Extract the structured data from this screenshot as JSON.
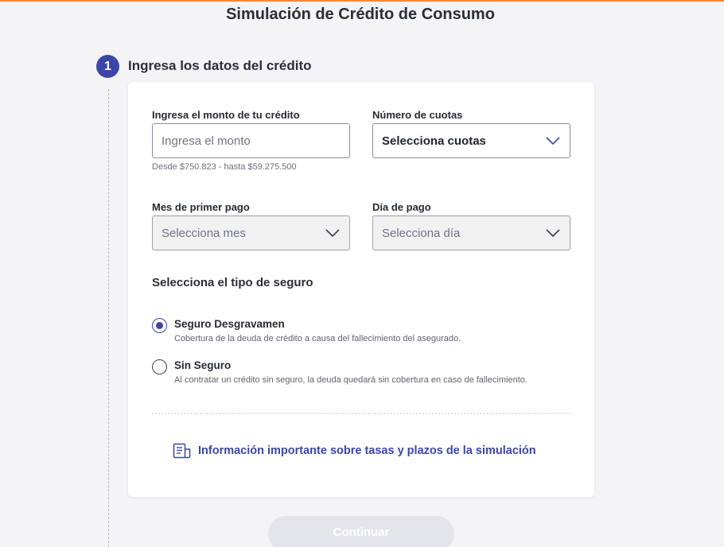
{
  "page": {
    "title": "Simulación de Crédito de Consumo"
  },
  "step": {
    "number": "1",
    "title": "Ingresa los datos del crédito"
  },
  "form": {
    "amount": {
      "label": "Ingresa el monto de tu crédito",
      "placeholder": "Ingresa el monto",
      "value": "",
      "hint": "Desde $750.823 - hasta $59.275.500"
    },
    "installments": {
      "label": "Número de cuotas",
      "value": "Selecciona cuotas"
    },
    "first_payment_month": {
      "label": "Mes de primer pago",
      "value": "Selecciona mes"
    },
    "payment_day": {
      "label": "Día de pago",
      "value": "Selecciona día"
    }
  },
  "insurance": {
    "title": "Selecciona el tipo de seguro",
    "options": [
      {
        "label": "Seguro Desgravamen",
        "description": "Cobertura de la deuda de crédito a causa del fallecimiento del asegurado.",
        "selected": true
      },
      {
        "label": "Sin Seguro",
        "description": "Al contratar un crédito sin seguro, la deuda quedará sin cobertura en caso de fallecimiento.",
        "selected": false
      }
    ]
  },
  "info_link": {
    "label": "Información importante sobre tasas y plazos de la simulación",
    "icon": "document-icon"
  },
  "actions": {
    "continue_label": "Continuar"
  },
  "colors": {
    "accent": "#3b46a8",
    "top_bar": "#ef8a3c",
    "disabled_button": "#e4e5e8"
  }
}
